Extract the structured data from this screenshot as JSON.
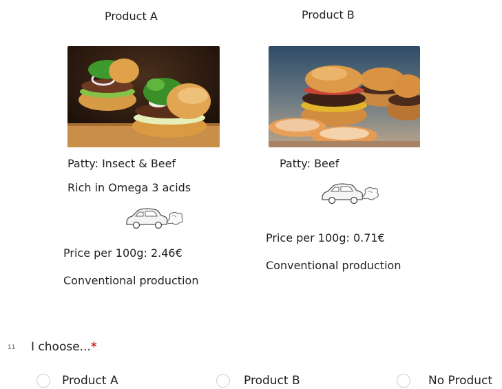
{
  "product_a": {
    "title": "Product A",
    "image_icon": "insect-beef-burger-photo",
    "patty": "Patty: Insect & Beef",
    "extra": "Rich in Omega 3 acids",
    "emission_icon": "car-exhaust-icon",
    "price": "Price per 100g: 2.46€",
    "production": "Conventional production"
  },
  "product_b": {
    "title": "Product B",
    "image_icon": "beef-burger-photo",
    "patty": "Patty: Beef",
    "emission_icon": "car-exhaust-icon",
    "price": "Price per 100g: 0.71€",
    "production": "Conventional production"
  },
  "question": {
    "number": "11",
    "text": "I choose...",
    "required_mark": "*",
    "required_color": "#d11a1a",
    "options": [
      {
        "label": "Product A",
        "selected": false
      },
      {
        "label": "Product B",
        "selected": false
      },
      {
        "label": "No Product",
        "selected": false
      }
    ]
  }
}
